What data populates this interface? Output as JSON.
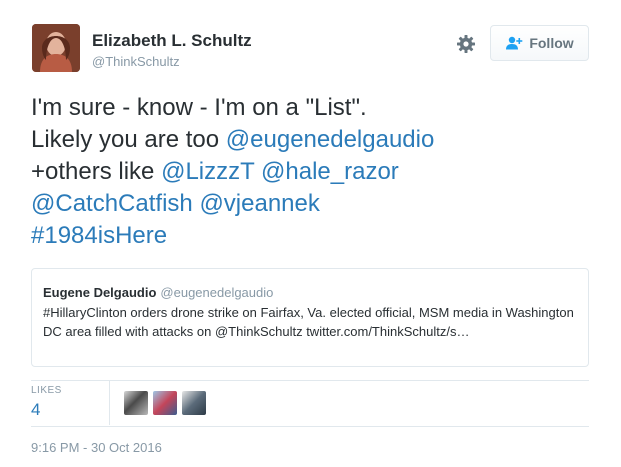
{
  "author": {
    "display_name": "Elizabeth L. Schultz",
    "handle": "@ThinkSchultz",
    "avatar_icon": "profile-photo"
  },
  "actions": {
    "settings_icon": "gear-icon",
    "follow_label": "Follow",
    "follow_icon": "add-user-icon"
  },
  "tweet": {
    "line1": "I'm sure - know - I'm on a \"List\".",
    "line2_text": "Likely you are too ",
    "line2_mention": "@eugenedelgaudio",
    "line3_text": "+others like ",
    "line3_mention1": "@LizzzT",
    "line3_mention2": "@hale_razor",
    "line4_mention1": "@CatchCatfish",
    "line4_mention2": "@vjeannek",
    "line5_hashtag": "#1984isHere"
  },
  "quoted_tweet": {
    "author_name": "Eugene Delgaudio",
    "author_handle": "@eugenedelgaudio",
    "text": "#HillaryClinton orders drone strike on Fairfax, Va. elected official, MSM media in Washington DC area filled with attacks on @ThinkSchultz twitter.com/ThinkSchultz/s…"
  },
  "stats": {
    "likes_label": "LIKES",
    "likes_count": "4"
  },
  "timestamp": "9:16 PM - 30 Oct 2016",
  "colors": {
    "link": "#2b7bb9",
    "text": "#292f33",
    "muted": "#8899a6",
    "border": "#e1e8ed"
  }
}
